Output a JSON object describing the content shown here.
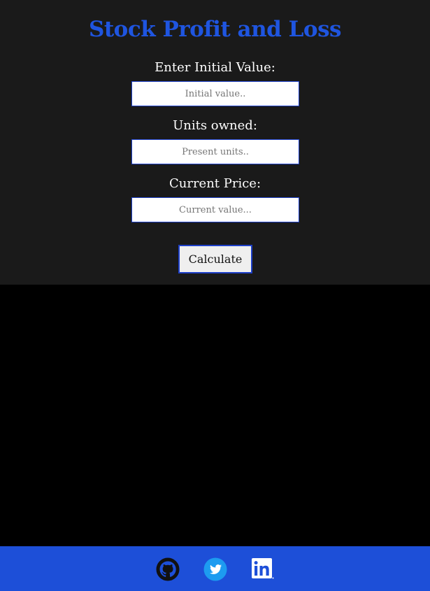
{
  "header": {
    "title": "Stock Profit and Loss"
  },
  "form": {
    "initial": {
      "label": "Enter Initial Value:",
      "placeholder": "Initial value.."
    },
    "units": {
      "label": "Units owned:",
      "placeholder": "Present units.."
    },
    "current": {
      "label": "Current Price:",
      "placeholder": "Current value..."
    },
    "submit_label": "Calculate"
  },
  "footer": {
    "links": [
      {
        "icon": "github-icon"
      },
      {
        "icon": "twitter-icon"
      },
      {
        "icon": "linkedin-icon"
      }
    ]
  },
  "colors": {
    "accent": "#1f55e0",
    "footer_bg": "#1d4fd8",
    "card_bg": "#1a1a1a",
    "page_bg": "#000000",
    "twitter": "#1d9bf0"
  }
}
